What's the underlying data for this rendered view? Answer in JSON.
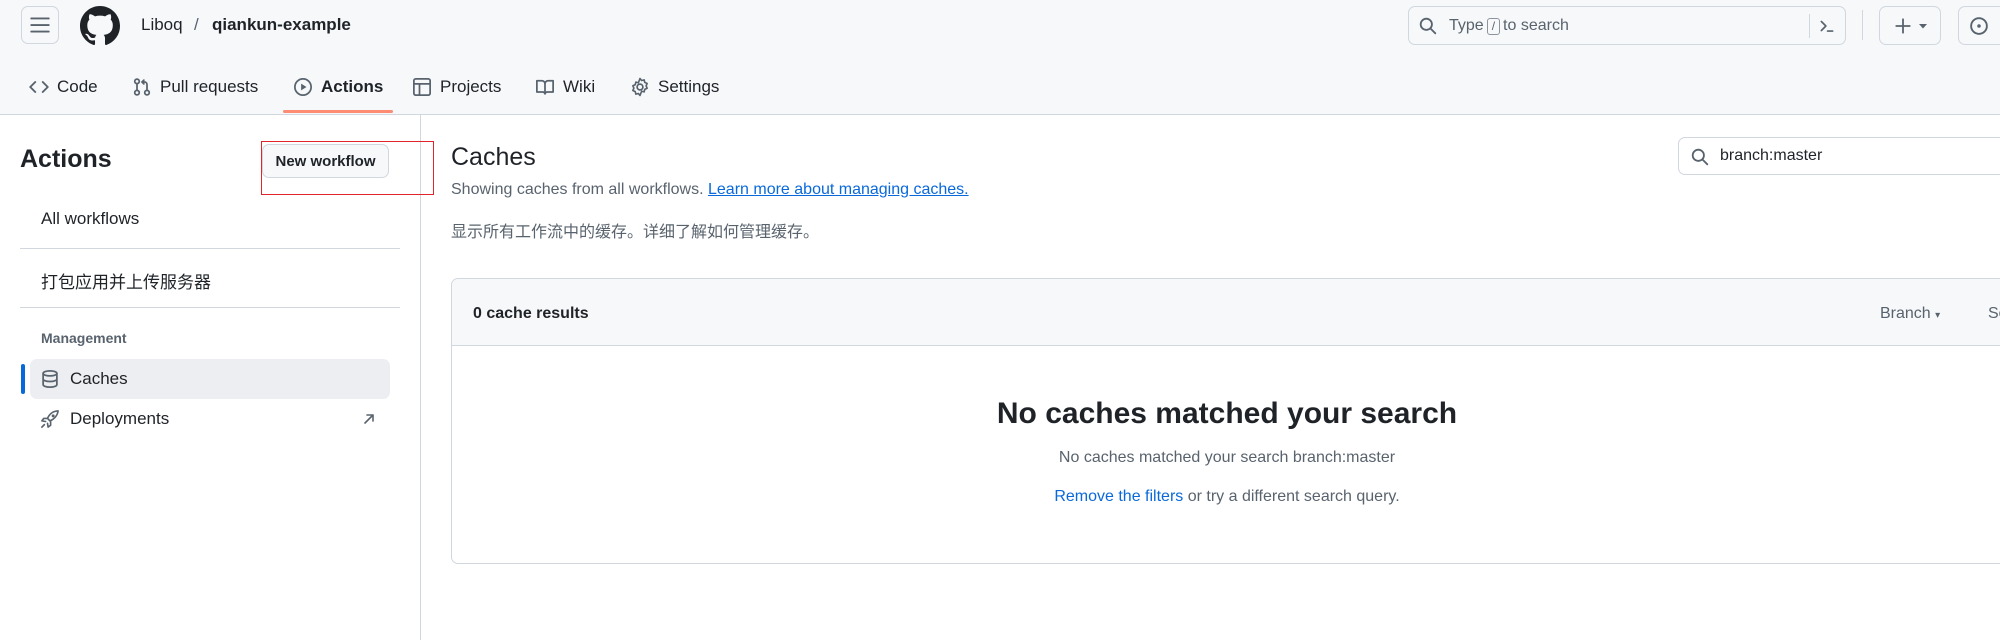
{
  "header": {
    "owner": "Liboq",
    "separator": "/",
    "repo": "qiankun-example",
    "search": {
      "prefix": "Type",
      "key": "/",
      "suffix": "to search"
    },
    "plus_label": "+"
  },
  "nav": {
    "tabs": [
      {
        "label": "Code",
        "icon": "code-icon"
      },
      {
        "label": "Pull requests",
        "icon": "git-pull-request-icon"
      },
      {
        "label": "Actions",
        "icon": "play-icon",
        "active": true
      },
      {
        "label": "Projects",
        "icon": "table-icon"
      },
      {
        "label": "Wiki",
        "icon": "book-icon"
      },
      {
        "label": "Settings",
        "icon": "gear-icon"
      }
    ]
  },
  "sidebar": {
    "title": "Actions",
    "new_workflow": "New workflow",
    "items": [
      {
        "label": "All workflows"
      },
      {
        "label": "打包应用并上传服务器"
      }
    ],
    "management_label": "Management",
    "management": [
      {
        "label": "Caches",
        "icon": "database-icon",
        "selected": true
      },
      {
        "label": "Deployments",
        "icon": "rocket-icon",
        "trailing_icon": "arrow-up-right-icon"
      }
    ]
  },
  "main": {
    "title": "Caches",
    "subtitle": "Showing caches from all workflows.",
    "subtitle_link": "Learn more about managing caches.",
    "chinese_note": "显示所有工作流中的缓存。详细了解如何管理缓存。",
    "filter_value": "branch:master",
    "results_count": "0 cache results",
    "branch_filter": "Branch",
    "sort_filter": "Sort",
    "blank_title": "No caches matched your search",
    "blank_text": "No caches matched your search branch:master",
    "remove_filters": "Remove the filters",
    "blank_hint_rest": " or try a different search query."
  },
  "colors": {
    "accent": "#0969da",
    "tab_underline": "#fd8c73",
    "annotation_box": "#e0242a"
  }
}
